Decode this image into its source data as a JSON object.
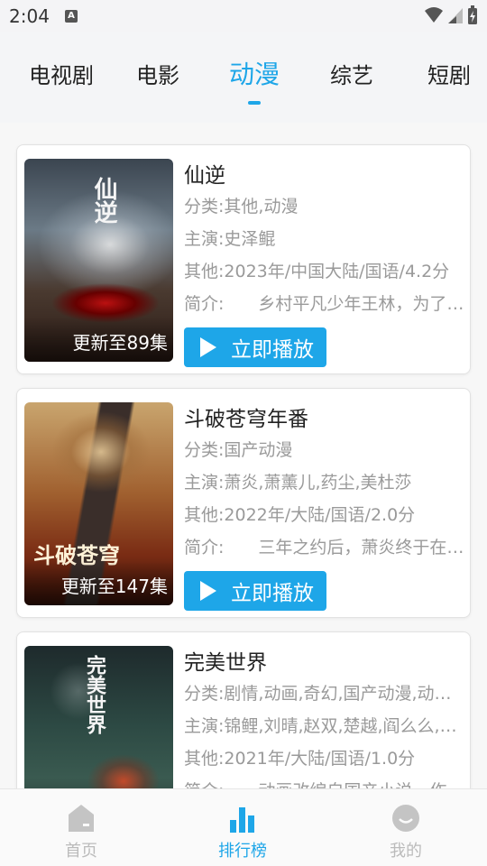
{
  "status": {
    "time": "2:04",
    "a_label": "A"
  },
  "tabs": [
    {
      "label": "电视剧"
    },
    {
      "label": "电影"
    },
    {
      "label": "动漫"
    },
    {
      "label": "综艺"
    },
    {
      "label": "短剧"
    }
  ],
  "active_tab": "动漫",
  "accent_color": "#1ea6e8",
  "cards": [
    {
      "title": "仙逆",
      "category": "分类:其他,动漫",
      "cast": "主演:史泽鲲",
      "other": "其他:2023年/中国大陆/国语/4.2分",
      "intro": "简介:　　乡村平凡少年王林，为了…",
      "update": "更新至89集",
      "poster_text": "仙逆",
      "play_label": "立即播放"
    },
    {
      "title": "斗破苍穹年番",
      "category": "分类:国产动漫",
      "cast": "主演:萧炎,萧薰儿,药尘,美杜莎",
      "other": "其他:2022年/大陆/国语/2.0分",
      "intro": "简介:　　三年之约后，萧炎终于在…",
      "update": "更新至147集",
      "poster_text": "斗破苍穹",
      "play_label": "立即播放"
    },
    {
      "title": "完美世界",
      "category": "分类:剧情,动画,奇幻,国产动漫,动…",
      "cast": "主演:锦鲤,刘晴,赵双,楚越,阎么么,…",
      "other": "其他:2021年/大陆/国语/1.0分",
      "intro": "简介:　　动画改编自国产小说，作…",
      "poster_text": "完美世界"
    }
  ],
  "bottom_nav": [
    {
      "label": "首页",
      "icon": "home-icon"
    },
    {
      "label": "排行榜",
      "icon": "chart-icon"
    },
    {
      "label": "我的",
      "icon": "profile-icon"
    }
  ]
}
